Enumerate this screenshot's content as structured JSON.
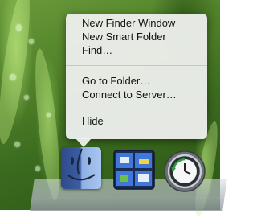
{
  "context_menu": {
    "items_group1": [
      "New Finder Window",
      "New Smart Folder",
      "Find…"
    ],
    "items_group2": [
      "Go to Folder…",
      "Connect to Server…"
    ],
    "items_group3": [
      "Hide"
    ]
  },
  "dock": {
    "items": [
      {
        "name": "Finder",
        "icon": "finder-icon"
      },
      {
        "name": "Spaces",
        "icon": "spaces-icon"
      },
      {
        "name": "Time Machine",
        "icon": "time-machine-icon"
      }
    ]
  },
  "colors": {
    "menu_bg": "#f2f2f2",
    "menu_text": "#111111",
    "wallpaper": "#4f7f28"
  }
}
